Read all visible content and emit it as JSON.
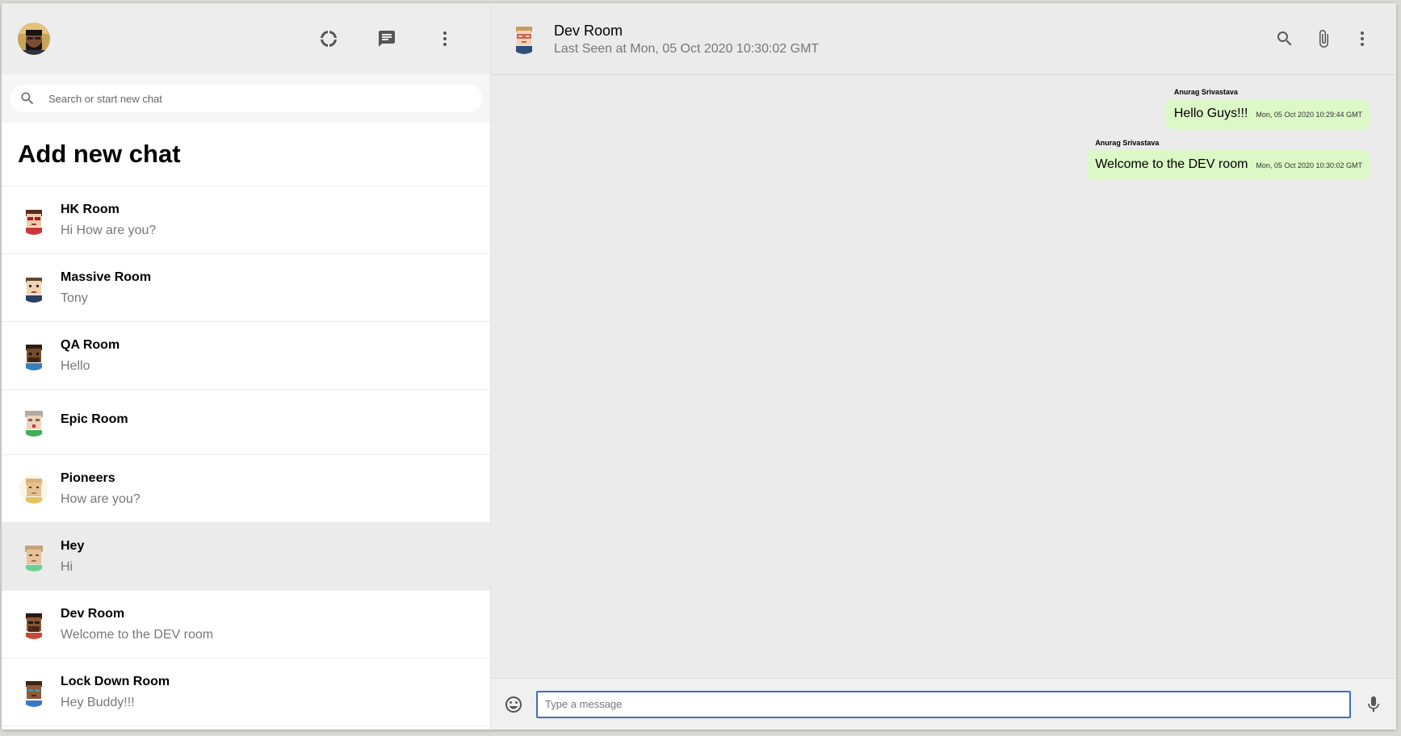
{
  "sidebar": {
    "header": {
      "avatar": "user-avatar",
      "icons": [
        "status-icon",
        "new-chat-icon",
        "more-vert-icon"
      ]
    },
    "search": {
      "placeholder": "Search or start new chat"
    },
    "add_new_chat": "Add new chat",
    "chats": [
      {
        "name": "HK Room",
        "last_message": "Hi How are you?"
      },
      {
        "name": "Massive Room",
        "last_message": "Tony"
      },
      {
        "name": "QA Room",
        "last_message": "Hello"
      },
      {
        "name": "Epic Room",
        "last_message": ""
      },
      {
        "name": "Pioneers",
        "last_message": "How are you?"
      },
      {
        "name": "Hey",
        "last_message": "Hi",
        "active": true
      },
      {
        "name": "Dev Room",
        "last_message": "Welcome to the DEV room"
      },
      {
        "name": "Lock Down Room",
        "last_message": "Hey Buddy!!!"
      }
    ]
  },
  "chat": {
    "header": {
      "title": "Dev Room",
      "subtitle": "Last Seen at Mon, 05 Oct 2020 10:30:02 GMT",
      "icons": [
        "search-icon",
        "attach-icon",
        "more-vert-icon"
      ]
    },
    "messages": [
      {
        "sender": "Anurag Srivastava",
        "text": "Hello Guys!!!",
        "time": "Mon, 05 Oct 2020 10:29:44 GMT"
      },
      {
        "sender": "Anurag Srivastava",
        "text": "Welcome to the DEV room",
        "time": "Mon, 05 Oct 2020 10:30:02 GMT"
      }
    ],
    "footer": {
      "placeholder": "Type a message",
      "icons": [
        "emoji-icon",
        "mic-icon"
      ]
    }
  },
  "colors": {
    "bubble": "#dcf8c6",
    "input_border": "#3f6ec2",
    "header_bg": "#ededed",
    "active_chat_bg": "#ebebeb"
  }
}
